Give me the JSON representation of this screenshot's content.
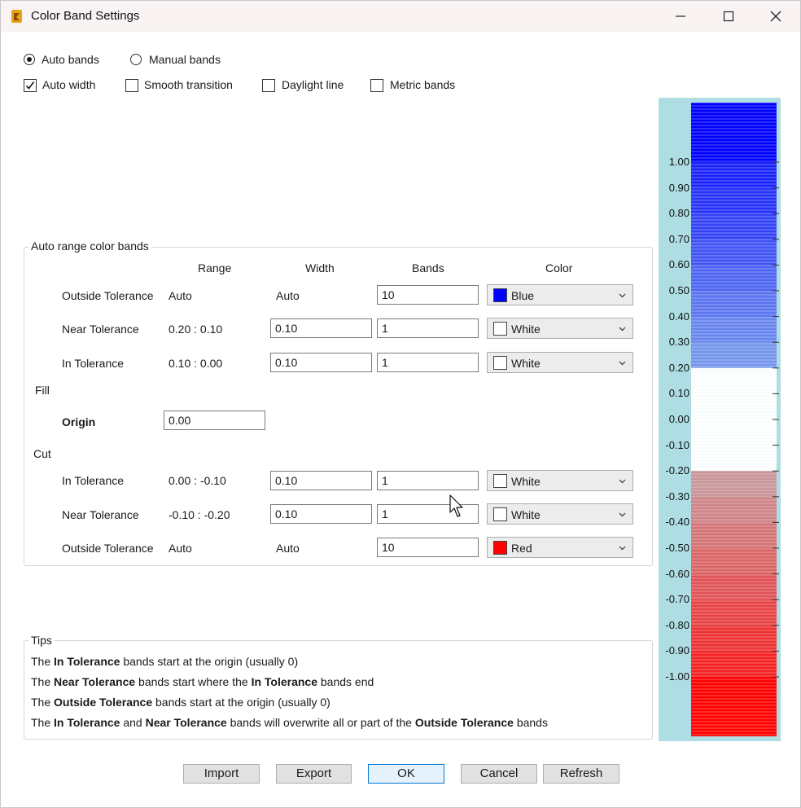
{
  "window": {
    "title": "Color Band Settings"
  },
  "mode": {
    "auto_label": "Auto bands",
    "manual_label": "Manual bands",
    "selected": "auto"
  },
  "options": {
    "auto_width": {
      "label": "Auto width",
      "checked": true
    },
    "smooth_transition": {
      "label": "Smooth transition",
      "checked": false
    },
    "daylight_line": {
      "label": "Daylight line",
      "checked": false
    },
    "metric_bands": {
      "label": "Metric bands",
      "checked": false
    }
  },
  "auto_range": {
    "title": "Auto range color bands",
    "headers": {
      "range": "Range",
      "width": "Width",
      "bands": "Bands",
      "color": "Color"
    },
    "fill_label": "Fill",
    "cut_label": "Cut",
    "origin_label": "Origin",
    "origin_value": "0.00",
    "fill_rows": [
      {
        "name": "Outside Tolerance",
        "range": "Auto",
        "width": "Auto",
        "bands": "10",
        "color_name": "Blue",
        "color": "#0000ff"
      },
      {
        "name": "Near Tolerance",
        "range": "0.20 : 0.10",
        "width": "0.10",
        "bands": "1",
        "color_name": "White",
        "color": "#ffffff"
      },
      {
        "name": "In Tolerance",
        "range": "0.10 : 0.00",
        "width": "0.10",
        "bands": "1",
        "color_name": "White",
        "color": "#ffffff"
      }
    ],
    "cut_rows": [
      {
        "name": "In Tolerance",
        "range": "0.00 : -0.10",
        "width": "0.10",
        "bands": "1",
        "color_name": "White",
        "color": "#ffffff"
      },
      {
        "name": "Near Tolerance",
        "range": "-0.10 : -0.20",
        "width": "0.10",
        "bands": "1",
        "color_name": "White",
        "color": "#ffffff"
      },
      {
        "name": "Outside Tolerance",
        "range": "Auto",
        "width": "Auto",
        "bands": "10",
        "color_name": "Red",
        "color": "#ff0000"
      }
    ]
  },
  "tips": {
    "title": "Tips",
    "lines": [
      [
        {
          "t": "The "
        },
        {
          "t": "In Tolerance",
          "b": true
        },
        {
          "t": " bands start at the origin (usually 0)"
        }
      ],
      [
        {
          "t": "The "
        },
        {
          "t": "Near Tolerance",
          "b": true
        },
        {
          "t": " bands start where the "
        },
        {
          "t": "In Tolerance",
          "b": true
        },
        {
          "t": " bands end"
        }
      ],
      [
        {
          "t": "The "
        },
        {
          "t": "Outside Tolerance",
          "b": true
        },
        {
          "t": " bands start at the origin (usually 0)"
        }
      ],
      [
        {
          "t": "The "
        },
        {
          "t": "In Tolerance",
          "b": true
        },
        {
          "t": " and "
        },
        {
          "t": "Near Tolerance",
          "b": true
        },
        {
          "t": " bands will overwrite all or part of the "
        },
        {
          "t": "Outside Tolerance",
          "b": true
        },
        {
          "t": " bands"
        }
      ]
    ]
  },
  "buttons": {
    "import": "Import",
    "export": "Export",
    "ok": "OK",
    "cancel": "Cancel",
    "refresh": "Refresh"
  },
  "scale": {
    "labels": [
      "1.00",
      "0.90",
      "0.80",
      "0.70",
      "0.60",
      "0.50",
      "0.40",
      "0.30",
      "0.20",
      "0.10",
      "0.00",
      "-0.10",
      "-0.20",
      "-0.30",
      "-0.40",
      "-0.50",
      "-0.60",
      "-0.70",
      "-0.80",
      "-0.90",
      "-1.00"
    ],
    "background": "#aedde3",
    "fill_color": "#0000ff",
    "cut_color": "#ff0000",
    "tolerance_color": "#ffffff"
  },
  "icons": {
    "app": "app-icon",
    "minimize": "minimize-icon",
    "maximize": "maximize-icon",
    "close": "close-icon",
    "dropdown": "chevron-down-icon"
  }
}
